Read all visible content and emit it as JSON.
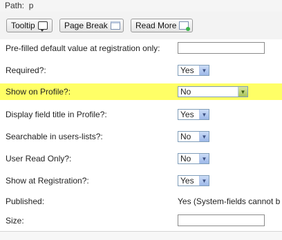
{
  "path_bar": {
    "label": "Path:",
    "value": "p"
  },
  "toolbar": {
    "buttons": [
      {
        "label": "Tooltip",
        "icon": "tooltip-icon"
      },
      {
        "label": "Page Break",
        "icon": "page-break-icon"
      },
      {
        "label": "Read More",
        "icon": "read-more-icon"
      }
    ]
  },
  "form": {
    "rows": [
      {
        "label": "Pre-filled default value at registration only:",
        "type": "text",
        "value": ""
      },
      {
        "label": "Required?:",
        "type": "select",
        "value": "Yes"
      },
      {
        "label": "Show on Profile?:",
        "type": "select",
        "value": "No",
        "highlight": "#ffff66"
      },
      {
        "label": "Display field title in Profile?:",
        "type": "select",
        "value": "Yes"
      },
      {
        "label": "Searchable in users-lists?:",
        "type": "select",
        "value": "No"
      },
      {
        "label": "User Read Only?:",
        "type": "select",
        "value": "No"
      },
      {
        "label": "Show at Registration?:",
        "type": "select",
        "value": "Yes"
      },
      {
        "label": "Published:",
        "type": "static",
        "value": "Yes (System-fields cannot b"
      },
      {
        "label": "Size:",
        "type": "text",
        "value": ""
      }
    ]
  }
}
